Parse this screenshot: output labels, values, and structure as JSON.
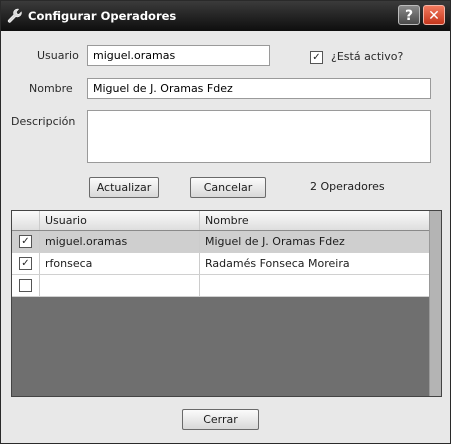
{
  "window": {
    "title": "Configurar Operadores"
  },
  "titlebar": {
    "help_glyph": "?",
    "close_glyph": "✕"
  },
  "form": {
    "usuario_label": "Usuario",
    "usuario_value": "miguel.oramas",
    "activo_label": "¿Está activo?",
    "activo_checked": true,
    "nombre_label": "Nombre",
    "nombre_value": "Miguel de J. Oramas Fdez",
    "descripcion_label": "Descripción",
    "descripcion_value": ""
  },
  "actions": {
    "actualizar": "Actualizar",
    "cancelar": "Cancelar",
    "count_text": "2 Operadores"
  },
  "table": {
    "columns": [
      "Usuario",
      "Nombre"
    ],
    "rows": [
      {
        "checked": true,
        "usuario": "miguel.oramas",
        "nombre": "Miguel de J. Oramas Fdez",
        "selected": true
      },
      {
        "checked": true,
        "usuario": "rfonseca",
        "nombre": "Radamés Fonseca Moreira",
        "selected": false
      },
      {
        "checked": false,
        "usuario": "",
        "nombre": "",
        "selected": false
      }
    ]
  },
  "footer": {
    "cerrar": "Cerrar"
  },
  "check_glyph": "✓",
  "colors": {
    "selected_row": "#cfcfcf",
    "grid_empty": "#6f6f6f",
    "close_button": "#d9472b"
  }
}
